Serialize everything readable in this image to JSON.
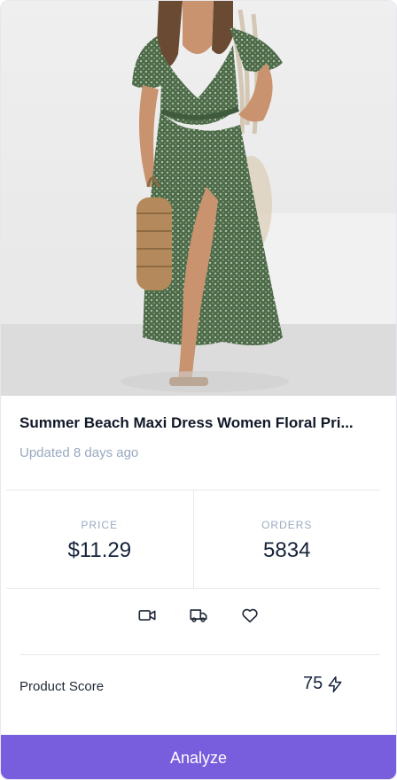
{
  "product": {
    "title": "Summer Beach Maxi Dress Women Floral Pri...",
    "updated": "Updated 8 days ago",
    "image_icon": "product-photo-green-floral-dress"
  },
  "stats": {
    "price_label": "PRICE",
    "price_value": "$11.29",
    "orders_label": "ORDERS",
    "orders_value": "5834"
  },
  "actions": {
    "icons": [
      "video-icon",
      "truck-icon",
      "heart-icon"
    ]
  },
  "score": {
    "label": "Product Score",
    "value": "75",
    "icon": "bolt-icon"
  },
  "cta": {
    "label": "Analyze"
  },
  "colors": {
    "accent": "#785ddc",
    "muted_text": "#9aa9c0",
    "dark_text": "#16233a"
  }
}
